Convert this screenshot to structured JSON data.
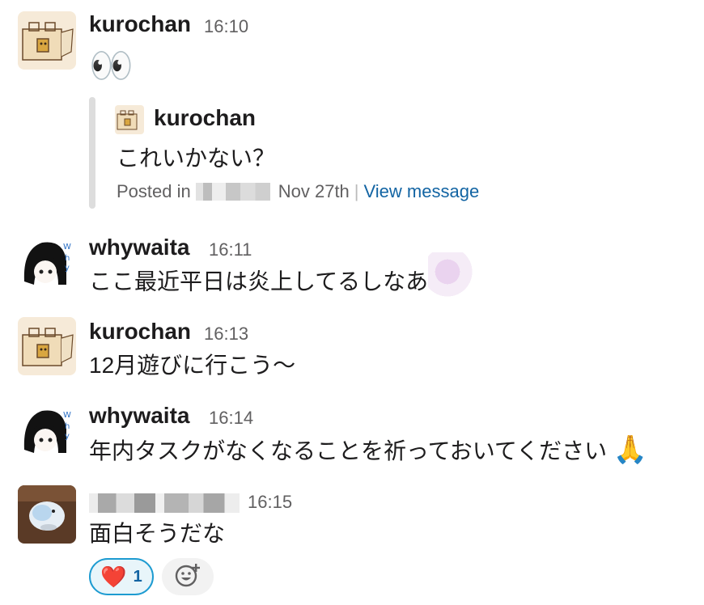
{
  "messages": [
    {
      "author": "kurochan",
      "time": "16:10",
      "text": "👀",
      "quote": {
        "author": "kurochan",
        "text": "これいかない？",
        "posted_in_label": "Posted in",
        "date": "Nov 27th",
        "separator": "|",
        "link": "View message"
      }
    },
    {
      "author": "whywaita",
      "time": "16:11",
      "text": "ここ最近平日は炎上してるしなあ"
    },
    {
      "author": "kurochan",
      "time": "16:13",
      "text": "12月遊びに行こう〜"
    },
    {
      "author": "whywaita",
      "time": "16:14",
      "text": "年内タスクがなくなることを祈っておいてください",
      "emoji": "🙏"
    },
    {
      "author": "",
      "time": "16:15",
      "text": "面白そうだな"
    }
  ],
  "reaction": {
    "emoji": "❤️",
    "count": "1",
    "icon": "heart-icon"
  },
  "add_reaction": {
    "icon": "add-emoji-icon"
  },
  "colors": {
    "link": "#1264a3",
    "reaction_border": "#1d9bd1",
    "reaction_bg": "#e8f5fa",
    "muted": "#616061"
  }
}
